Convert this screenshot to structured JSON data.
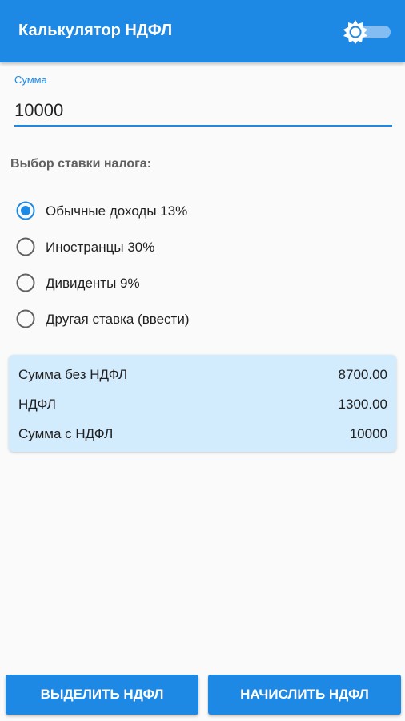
{
  "app": {
    "title": "Калькулятор НДФЛ",
    "theme_toggle_icon": "brightness-sun-icon",
    "theme_toggle_on": false
  },
  "amount_field": {
    "label": "Сумма",
    "value": "10000"
  },
  "tax_rate": {
    "heading": "Выбор ставки налога:",
    "options": [
      {
        "label": "Обычные доходы 13%",
        "selected": true
      },
      {
        "label": "Иностранцы 30%",
        "selected": false
      },
      {
        "label": "Дивиденты 9%",
        "selected": false
      },
      {
        "label": "Другая ставка (ввести)",
        "selected": false
      }
    ]
  },
  "results": [
    {
      "label": "Сумма без НДФЛ",
      "value": "8700.00"
    },
    {
      "label": "НДФЛ",
      "value": "1300.00"
    },
    {
      "label": "Сумма с НДФЛ",
      "value": "10000"
    }
  ],
  "actions": {
    "extract_label": "ВЫДЕЛИТЬ НДФЛ",
    "add_label": "НАЧИСЛИТЬ НДФЛ"
  },
  "colors": {
    "primary": "#1e88e5",
    "result_bg": "#d2ebfd",
    "background": "#fafafa"
  }
}
